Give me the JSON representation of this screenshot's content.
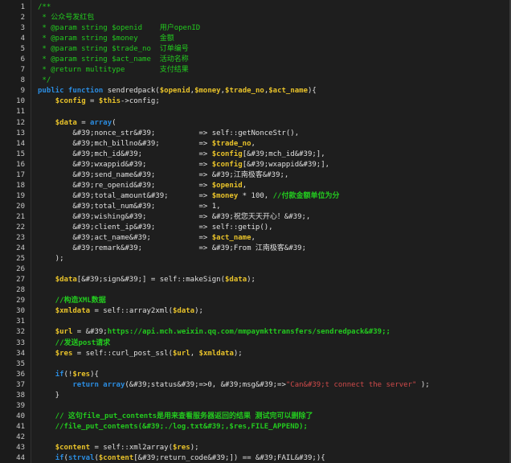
{
  "editor": {
    "lines": [
      {
        "n": "1",
        "segs": [
          {
            "t": "/**",
            "c": "c-doc"
          }
        ]
      },
      {
        "n": "2",
        "segs": [
          {
            "t": " * 公众号发红包",
            "c": "c-doc"
          }
        ]
      },
      {
        "n": "3",
        "segs": [
          {
            "t": " * @param string $openid    用户openID",
            "c": "c-doc"
          }
        ]
      },
      {
        "n": "4",
        "segs": [
          {
            "t": " * @param string $money     金额",
            "c": "c-doc"
          }
        ]
      },
      {
        "n": "5",
        "segs": [
          {
            "t": " * @param string $trade_no  订单编号",
            "c": "c-doc"
          }
        ]
      },
      {
        "n": "6",
        "segs": [
          {
            "t": " * @param string $act_name  活动名称",
            "c": "c-doc"
          }
        ]
      },
      {
        "n": "7",
        "segs": [
          {
            "t": " * @return multitype        支付结果",
            "c": "c-doc"
          }
        ]
      },
      {
        "n": "8",
        "segs": [
          {
            "t": " */",
            "c": "c-doc"
          }
        ]
      },
      {
        "n": "9",
        "segs": [
          {
            "t": "public function ",
            "c": "c-kw"
          },
          {
            "t": "sendredpack(",
            "c": "c-plain"
          },
          {
            "t": "$openid",
            "c": "c-var"
          },
          {
            "t": ",",
            "c": "c-plain"
          },
          {
            "t": "$money",
            "c": "c-var"
          },
          {
            "t": ",",
            "c": "c-plain"
          },
          {
            "t": "$trade_no",
            "c": "c-var"
          },
          {
            "t": ",",
            "c": "c-plain"
          },
          {
            "t": "$act_name",
            "c": "c-var"
          },
          {
            "t": "){",
            "c": "c-plain"
          }
        ]
      },
      {
        "n": "10",
        "segs": [
          {
            "t": "    ",
            "c": "c-plain"
          },
          {
            "t": "$config",
            "c": "c-var"
          },
          {
            "t": " = ",
            "c": "c-plain"
          },
          {
            "t": "$this",
            "c": "c-var"
          },
          {
            "t": "->config;",
            "c": "c-plain"
          }
        ]
      },
      {
        "n": "11",
        "segs": []
      },
      {
        "n": "12",
        "segs": [
          {
            "t": "    ",
            "c": "c-plain"
          },
          {
            "t": "$data",
            "c": "c-var"
          },
          {
            "t": " = ",
            "c": "c-plain"
          },
          {
            "t": "array",
            "c": "c-kw"
          },
          {
            "t": "(",
            "c": "c-plain"
          }
        ]
      },
      {
        "n": "13",
        "segs": [
          {
            "t": "        &#39;nonce_str&#39;          => self::getNonceStr(),",
            "c": "c-plain"
          }
        ]
      },
      {
        "n": "14",
        "segs": [
          {
            "t": "        &#39;mch_billno&#39;         => ",
            "c": "c-plain"
          },
          {
            "t": "$trade_no",
            "c": "c-var"
          },
          {
            "t": ",",
            "c": "c-plain"
          }
        ]
      },
      {
        "n": "15",
        "segs": [
          {
            "t": "        &#39;mch_id&#39;             => ",
            "c": "c-plain"
          },
          {
            "t": "$config",
            "c": "c-var"
          },
          {
            "t": "[&#39;mch_id&#39;],",
            "c": "c-plain"
          }
        ]
      },
      {
        "n": "16",
        "segs": [
          {
            "t": "        &#39;wxappid&#39;            => ",
            "c": "c-plain"
          },
          {
            "t": "$config",
            "c": "c-var"
          },
          {
            "t": "[&#39;wxappid&#39;],",
            "c": "c-plain"
          }
        ]
      },
      {
        "n": "17",
        "segs": [
          {
            "t": "        &#39;send_name&#39;          => &#39;江南极客&#39;,",
            "c": "c-plain"
          }
        ]
      },
      {
        "n": "18",
        "segs": [
          {
            "t": "        &#39;re_openid&#39;          => ",
            "c": "c-plain"
          },
          {
            "t": "$openid",
            "c": "c-var"
          },
          {
            "t": ",",
            "c": "c-plain"
          }
        ]
      },
      {
        "n": "19",
        "segs": [
          {
            "t": "        &#39;total_amount&#39;       => ",
            "c": "c-plain"
          },
          {
            "t": "$money",
            "c": "c-var"
          },
          {
            "t": " * 100, ",
            "c": "c-plain"
          },
          {
            "t": "//付款金额单位为分",
            "c": "c-green"
          }
        ]
      },
      {
        "n": "20",
        "segs": [
          {
            "t": "        &#39;total_num&#39;          => 1,",
            "c": "c-plain"
          }
        ]
      },
      {
        "n": "21",
        "segs": [
          {
            "t": "        &#39;wishing&#39;            => &#39;祝您天天开心！&#39;,",
            "c": "c-plain"
          }
        ]
      },
      {
        "n": "22",
        "segs": [
          {
            "t": "        &#39;client_ip&#39;          => self::getip(),",
            "c": "c-plain"
          }
        ]
      },
      {
        "n": "23",
        "segs": [
          {
            "t": "        &#39;act_name&#39;           => ",
            "c": "c-plain"
          },
          {
            "t": "$act_name",
            "c": "c-var"
          },
          {
            "t": ",",
            "c": "c-plain"
          }
        ]
      },
      {
        "n": "24",
        "segs": [
          {
            "t": "        &#39;remark&#39;             => &#39;From 江南极客&#39;",
            "c": "c-plain"
          }
        ]
      },
      {
        "n": "25",
        "segs": [
          {
            "t": "    );",
            "c": "c-plain"
          }
        ]
      },
      {
        "n": "26",
        "segs": []
      },
      {
        "n": "27",
        "segs": [
          {
            "t": "    ",
            "c": "c-plain"
          },
          {
            "t": "$data",
            "c": "c-var"
          },
          {
            "t": "[&#39;sign&#39;] = self::makeSign(",
            "c": "c-plain"
          },
          {
            "t": "$data",
            "c": "c-var"
          },
          {
            "t": ");",
            "c": "c-plain"
          }
        ]
      },
      {
        "n": "28",
        "segs": []
      },
      {
        "n": "29",
        "segs": [
          {
            "t": "    //构造XML数据",
            "c": "c-green"
          }
        ]
      },
      {
        "n": "30",
        "segs": [
          {
            "t": "    ",
            "c": "c-plain"
          },
          {
            "t": "$xmldata",
            "c": "c-var"
          },
          {
            "t": " = self::array2xml(",
            "c": "c-plain"
          },
          {
            "t": "$data",
            "c": "c-var"
          },
          {
            "t": ");",
            "c": "c-plain"
          }
        ]
      },
      {
        "n": "31",
        "segs": []
      },
      {
        "n": "32",
        "segs": [
          {
            "t": "    ",
            "c": "c-plain"
          },
          {
            "t": "$url",
            "c": "c-var"
          },
          {
            "t": " = &#39;",
            "c": "c-plain"
          },
          {
            "t": "https://api.mch.weixin.qq.com/mmpaymkttransfers/sendredpack&#39;;",
            "c": "c-green"
          }
        ]
      },
      {
        "n": "33",
        "segs": [
          {
            "t": "    //发送post请求",
            "c": "c-green"
          }
        ]
      },
      {
        "n": "34",
        "segs": [
          {
            "t": "    ",
            "c": "c-plain"
          },
          {
            "t": "$res",
            "c": "c-var"
          },
          {
            "t": " = self::curl_post_ssl(",
            "c": "c-plain"
          },
          {
            "t": "$url",
            "c": "c-var"
          },
          {
            "t": ", ",
            "c": "c-plain"
          },
          {
            "t": "$xmldata",
            "c": "c-var"
          },
          {
            "t": ");",
            "c": "c-plain"
          }
        ]
      },
      {
        "n": "35",
        "segs": []
      },
      {
        "n": "36",
        "segs": [
          {
            "t": "    ",
            "c": "c-plain"
          },
          {
            "t": "if",
            "c": "c-kw"
          },
          {
            "t": "(!",
            "c": "c-plain"
          },
          {
            "t": "$res",
            "c": "c-var"
          },
          {
            "t": "){",
            "c": "c-plain"
          }
        ]
      },
      {
        "n": "37",
        "segs": [
          {
            "t": "        ",
            "c": "c-plain"
          },
          {
            "t": "return array",
            "c": "c-kw"
          },
          {
            "t": "(&#39;status&#39;=>0, &#39;msg&#39;=>",
            "c": "c-plain"
          },
          {
            "t": "\"Can&#39;t connect the server\"",
            "c": "c-str"
          },
          {
            "t": " );",
            "c": "c-plain"
          }
        ]
      },
      {
        "n": "38",
        "segs": [
          {
            "t": "    }",
            "c": "c-plain"
          }
        ]
      },
      {
        "n": "39",
        "segs": []
      },
      {
        "n": "40",
        "segs": [
          {
            "t": "    // 这句file_put_contents是用来查看服务器返回的结果 测试完可以删除了",
            "c": "c-green"
          }
        ]
      },
      {
        "n": "41",
        "segs": [
          {
            "t": "    //file_put_contents(&#39;./log.txt&#39;,$res,FILE_APPEND);",
            "c": "c-green"
          }
        ]
      },
      {
        "n": "42",
        "segs": []
      },
      {
        "n": "43",
        "segs": [
          {
            "t": "    ",
            "c": "c-plain"
          },
          {
            "t": "$content",
            "c": "c-var"
          },
          {
            "t": " = self::xml2array(",
            "c": "c-plain"
          },
          {
            "t": "$res",
            "c": "c-var"
          },
          {
            "t": ");",
            "c": "c-plain"
          }
        ]
      },
      {
        "n": "44",
        "segs": [
          {
            "t": "    ",
            "c": "c-plain"
          },
          {
            "t": "if",
            "c": "c-kw"
          },
          {
            "t": "(",
            "c": "c-plain"
          },
          {
            "t": "strval",
            "c": "c-kw"
          },
          {
            "t": "(",
            "c": "c-plain"
          },
          {
            "t": "$content",
            "c": "c-var"
          },
          {
            "t": "[&#39;return_code&#39;]) == &#39;FAIL&#39;){",
            "c": "c-plain"
          }
        ]
      }
    ]
  }
}
